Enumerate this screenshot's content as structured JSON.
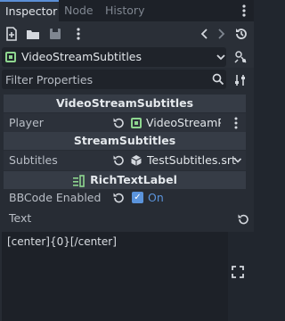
{
  "tabs": [
    {
      "label": "Inspector",
      "active": true
    },
    {
      "label": "Node",
      "active": false
    },
    {
      "label": "History",
      "active": false
    }
  ],
  "toolbar": {
    "icons": [
      "new-script-icon",
      "open-icon",
      "save-icon",
      "more-icon",
      "back-icon",
      "forward-icon",
      "history-icon"
    ]
  },
  "object": {
    "label": "VideoStreamSubtitles",
    "icon": "video-stream-icon"
  },
  "filter": {
    "placeholder": "Filter Properties",
    "value": ""
  },
  "sections": {
    "s1": "VideoStreamSubtitles",
    "s2": "StreamSubtitles",
    "s3": "RichTextLabel"
  },
  "props": {
    "player": {
      "label": "Player",
      "value": "VideoStreamPla"
    },
    "subtitles": {
      "label": "Subtitles",
      "value": "TestSubtitles.srt"
    },
    "bbcode": {
      "label": "BBCode Enabled",
      "value": "On",
      "checked": true
    },
    "text": {
      "label": "Text",
      "value": "[center]{0}[/center]"
    }
  },
  "colors": {
    "accent": "#5b94dc",
    "node_green": "#8ed68f",
    "background": "#272c34"
  }
}
